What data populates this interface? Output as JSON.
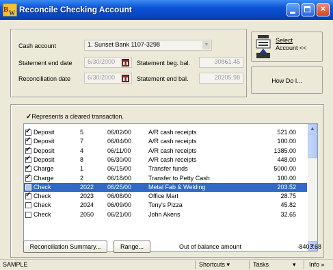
{
  "window": {
    "logo_text": "BW",
    "title": "Reconcile Checking Account",
    "colors": {
      "titlebar": "#0a52d6",
      "selection": "#316ac5",
      "close": "#d5441e"
    }
  },
  "form": {
    "cash_account_label": "Cash account",
    "cash_account_value": "1. Sunset Bank 1107-3298",
    "statement_end_date_label": "Statement end date",
    "statement_end_date_value": "6/30/2000",
    "reconciliation_date_label": "Reconciliation date",
    "reconciliation_date_value": "6/30/2000",
    "statement_beg_bal_label": "Statement beg. bal.",
    "statement_beg_bal_value": "30861.45",
    "statement_end_bal_label": "Statement end bal.",
    "statement_end_bal_value": "20205.98"
  },
  "actions": {
    "select_account_line1": "Select",
    "select_account_line2": "Account <<",
    "how_do_i": "How Do I..."
  },
  "legend": {
    "mark": "✓",
    "text": "Represents a cleared transaction."
  },
  "transactions": [
    {
      "cleared": true,
      "type": "Deposit",
      "num": "5",
      "date": "06/02/00",
      "description": "A/R cash receipts",
      "amount": "521.00",
      "selected": false
    },
    {
      "cleared": true,
      "type": "Deposit",
      "num": "7",
      "date": "06/04/00",
      "description": "A/R cash receipts",
      "amount": "100.00",
      "selected": false
    },
    {
      "cleared": true,
      "type": "Deposit",
      "num": "4",
      "date": "06/11/00",
      "description": "A/R cash receipts",
      "amount": "1385.00",
      "selected": false
    },
    {
      "cleared": true,
      "type": "Deposit",
      "num": "8",
      "date": "06/30/00",
      "description": "A/R cash receipts",
      "amount": "448.00",
      "selected": false
    },
    {
      "cleared": true,
      "type": "Charge",
      "num": "1",
      "date": "06/15/00",
      "description": "Transfer funds",
      "amount": "5000.00",
      "selected": false
    },
    {
      "cleared": true,
      "type": "Charge",
      "num": "2",
      "date": "06/18/00",
      "description": "Transfer to Petty Cash",
      "amount": "100.00",
      "selected": false
    },
    {
      "cleared": false,
      "type": "Check",
      "num": "2022",
      "date": "06/25/00",
      "description": "Metal Fab & Welding",
      "amount": "203.52",
      "selected": true
    },
    {
      "cleared": true,
      "type": "Check",
      "num": "2023",
      "date": "06/08/00",
      "description": "Office Mart",
      "amount": "28.75",
      "selected": false
    },
    {
      "cleared": false,
      "type": "Check",
      "num": "2024",
      "date": "06/09/00",
      "description": "Tony's Pizza",
      "amount": "45.82",
      "selected": false
    },
    {
      "cleared": false,
      "type": "Check",
      "num": "2050",
      "date": "06/21/00",
      "description": "John Akens",
      "amount": "32.65",
      "selected": false
    }
  ],
  "footer": {
    "reconciliation_summary": "Reconciliation Summary...",
    "range": "Range...",
    "out_of_balance_label": "Out of balance amount",
    "out_of_balance_value": "-8403.68"
  },
  "statusbar": {
    "company": "SAMPLE",
    "shortcuts": "Shortcuts",
    "tasks": "Tasks",
    "info": "Info"
  }
}
